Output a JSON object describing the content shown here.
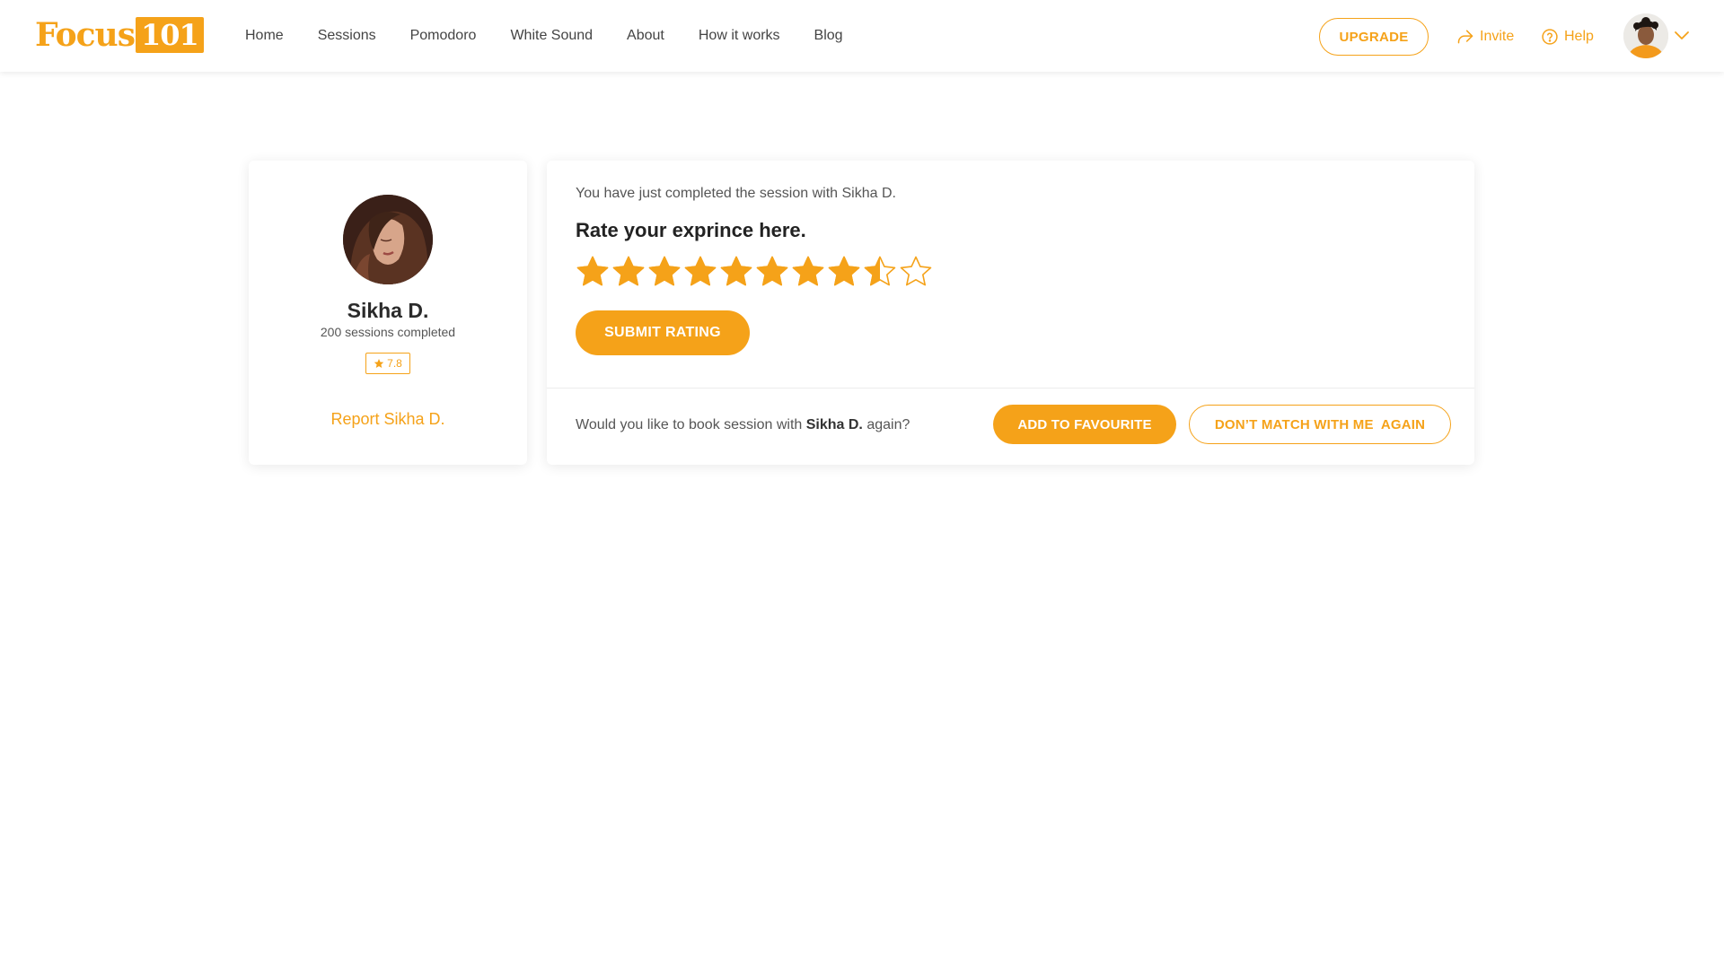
{
  "header": {
    "logo_text": "Focus",
    "logo_number": "101",
    "nav": [
      "Home",
      "Sessions",
      "Pomodoro",
      "White Sound",
      "About",
      "How it works",
      "Blog"
    ],
    "upgrade_label": "UPGRADE",
    "invite_label": "Invite",
    "help_label": "Help",
    "icons": {
      "invite": "share-arrow-icon",
      "help": "question-circle-icon",
      "menu": "chevron-down-icon"
    }
  },
  "profile": {
    "name": "Sikha D.",
    "sessions": "200 sessions completed",
    "rating": "7.8",
    "report_label": "Report Sikha D."
  },
  "rating_panel": {
    "completed_text": "You have just completed the session with Sikha D.",
    "heading": "Rate your exprince here.",
    "stars_total": 10,
    "stars_value": 8.5,
    "submit_label": "SUBMIT RATING",
    "rebook_prefix": "Would you like to book session with",
    "rebook_name": "Sikha D.",
    "rebook_suffix": "again?",
    "favourite_label": "ADD TO FAVOURITE",
    "no_match_label": "DON’T MATCH WITH ME  AGAIN"
  },
  "colors": {
    "accent": "#f5a219",
    "text_dark": "#222222",
    "background": "#ffffff"
  }
}
